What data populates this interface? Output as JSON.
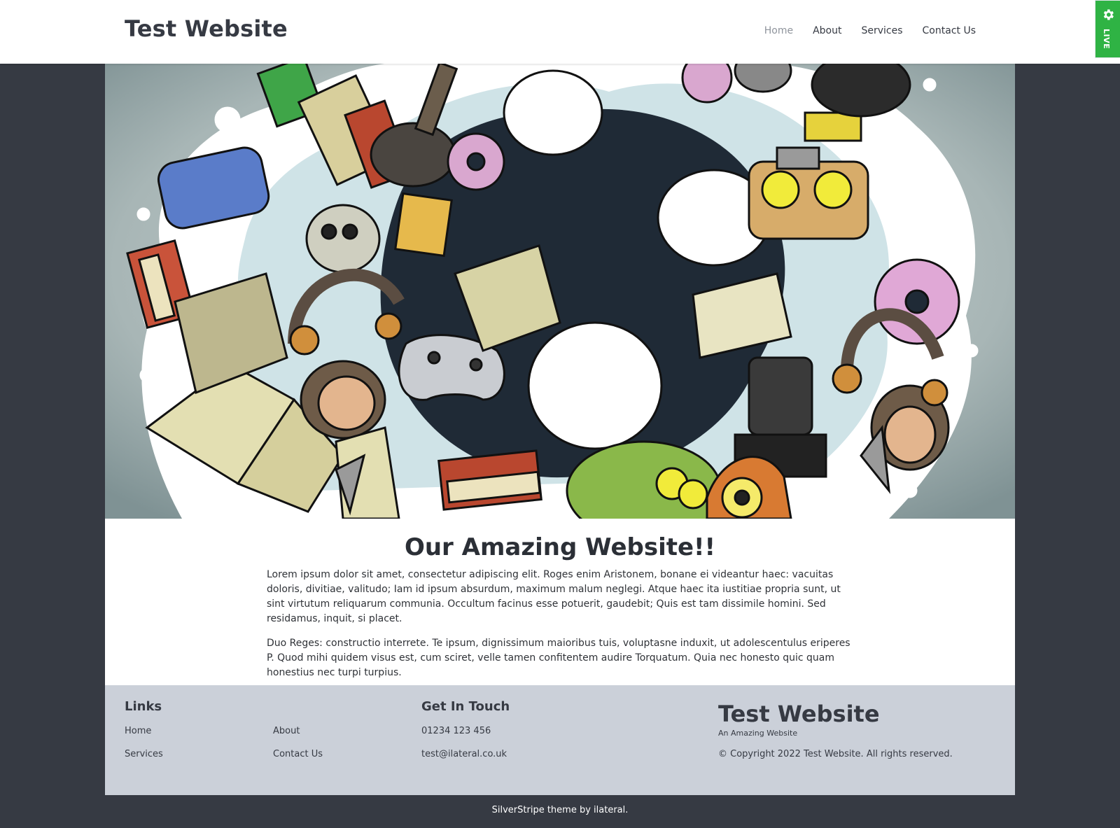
{
  "header": {
    "brand": "Test Website",
    "nav": [
      {
        "label": "Home",
        "current": true
      },
      {
        "label": "About",
        "current": false
      },
      {
        "label": "Services",
        "current": false
      },
      {
        "label": "Contact Us",
        "current": false
      }
    ]
  },
  "live_tab": {
    "label": "LIVE",
    "icon": "gear-icon",
    "color": "#2fb344"
  },
  "hero": {
    "image_description_icon": "doodle-illustration"
  },
  "content": {
    "title": "Our Amazing Website!!",
    "paragraphs": [
      "Lorem ipsum dolor sit amet, consectetur adipiscing elit. Roges enim Aristonem, bonane ei videantur haec: vacuitas doloris, divitiae, valitudo; Iam id ipsum absurdum, maximum malum neglegi. Atque haec ita iustitiae propria sunt, ut sint virtutum reliquarum communia. Occultum facinus esse potuerit, gaudebit; Quis est tam dissimile homini. Sed residamus, inquit, si placet.",
      "Duo Reges: constructio interrete. Te ipsum, dignissimum maioribus tuis, voluptasne induxit, ut adolescentulus eriperes P. Quod mihi quidem visus est, cum sciret, velle tamen confitentem audire Torquatum. Quia nec honesto quic quam honestius nec turpi turpius."
    ]
  },
  "footer": {
    "links_heading": "Links",
    "links": [
      "Home",
      "About",
      "Services",
      "Contact Us"
    ],
    "touch_heading": "Get In Touch",
    "phone": "01234 123 456",
    "email": "test@ilateral.co.uk",
    "brand": "Test Website",
    "tagline": "An Amazing Website",
    "copyright": "© Copyright 2022 Test Website. All rights reserved."
  },
  "credit": {
    "text": "SilverStripe theme by ilateral."
  },
  "colors": {
    "page_bg": "#363a43",
    "footer_bg": "#cbd0d9",
    "accent_green": "#2fb344"
  }
}
